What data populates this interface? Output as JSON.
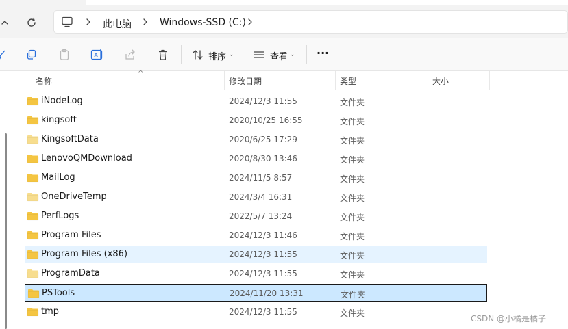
{
  "address": {
    "breadcrumbs": [
      {
        "label": "此电脑"
      },
      {
        "label": "Windows-SSD (C:)"
      }
    ]
  },
  "toolbar": {
    "sort_label": "排序",
    "view_label": "查看",
    "more_label": "···"
  },
  "columns": {
    "name": "名称",
    "date": "修改日期",
    "type": "类型",
    "size": "大小"
  },
  "rows": [
    {
      "name": "iNodeLog",
      "date": "2024/12/3 11:55",
      "type": "文件夹",
      "icon": "folder-icon",
      "state": "normal",
      "faded": false
    },
    {
      "name": "kingsoft",
      "date": "2020/10/25 16:55",
      "type": "文件夹",
      "icon": "folder-icon",
      "state": "normal",
      "faded": false
    },
    {
      "name": "KingsoftData",
      "date": "2020/6/25 17:29",
      "type": "文件夹",
      "icon": "folder-icon",
      "state": "normal",
      "faded": true
    },
    {
      "name": "LenovoQMDownload",
      "date": "2020/8/30 13:46",
      "type": "文件夹",
      "icon": "folder-icon",
      "state": "normal",
      "faded": false
    },
    {
      "name": "MailLog",
      "date": "2024/11/5 8:57",
      "type": "文件夹",
      "icon": "folder-icon",
      "state": "normal",
      "faded": false
    },
    {
      "name": "OneDriveTemp",
      "date": "2024/3/4 16:31",
      "type": "文件夹",
      "icon": "folder-icon",
      "state": "normal",
      "faded": true
    },
    {
      "name": "PerfLogs",
      "date": "2022/5/7 13:24",
      "type": "文件夹",
      "icon": "folder-icon",
      "state": "normal",
      "faded": false
    },
    {
      "name": "Program Files",
      "date": "2024/12/3 11:46",
      "type": "文件夹",
      "icon": "folder-icon",
      "state": "normal",
      "faded": false
    },
    {
      "name": "Program Files (x86)",
      "date": "2024/12/3 11:55",
      "type": "文件夹",
      "icon": "folder-icon",
      "state": "hover",
      "faded": false
    },
    {
      "name": "ProgramData",
      "date": "2024/12/3 11:55",
      "type": "文件夹",
      "icon": "folder-icon",
      "state": "normal",
      "faded": true
    },
    {
      "name": "PSTools",
      "date": "2024/11/20 13:31",
      "type": "文件夹",
      "icon": "folder-icon",
      "state": "selected",
      "faded": false
    },
    {
      "name": "tmp",
      "date": "2024/12/3 11:55",
      "type": "文件夹",
      "icon": "folder-icon",
      "state": "normal",
      "faded": false
    }
  ],
  "watermark": "CSDN @小橘是橘子",
  "colors": {
    "folder": "#f4c542",
    "folder_faded": "#f7dd8e",
    "selected_bg": "#cce8ff",
    "hover_bg": "#e5f3ff",
    "accent": "#0067c0"
  }
}
